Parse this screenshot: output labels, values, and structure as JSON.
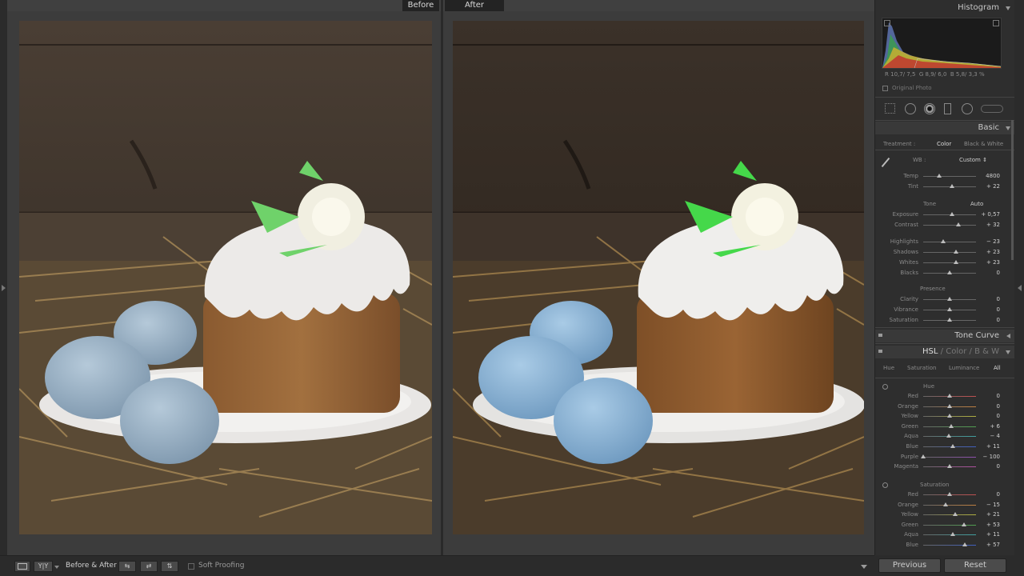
{
  "views": {
    "before_label": "Before",
    "after_label": "After"
  },
  "histogram": {
    "title": "Histogram",
    "readout_r_label": "R",
    "readout_r": "10,7/ 7,5",
    "readout_g_label": "G",
    "readout_g": "8,9/ 6,0",
    "readout_b_label": "B",
    "readout_b": "5,8/ 3,3",
    "readout_pct": "%",
    "original_photo": "Original Photo"
  },
  "basic": {
    "title": "Basic",
    "treatment_label": "Treatment :",
    "color_label": "Color",
    "bw_label": "Black & White",
    "wb_label": "WB :",
    "wb_value": "Custom",
    "tone_label": "Tone",
    "auto_label": "Auto",
    "presence_label": "Presence",
    "sliders_wb": [
      {
        "label": "Temp",
        "value": "4800",
        "pos": 0.3
      },
      {
        "label": "Tint",
        "value": "+ 22",
        "pos": 0.55
      }
    ],
    "sliders_tone": [
      {
        "label": "Exposure",
        "value": "+ 0,57",
        "pos": 0.55
      },
      {
        "label": "Contrast",
        "value": "+ 32",
        "pos": 0.66
      }
    ],
    "sliders_tone2": [
      {
        "label": "Highlights",
        "value": "− 23",
        "pos": 0.38
      },
      {
        "label": "Shadows",
        "value": "+ 23",
        "pos": 0.62
      },
      {
        "label": "Whites",
        "value": "+ 23",
        "pos": 0.62
      },
      {
        "label": "Blacks",
        "value": "0",
        "pos": 0.5
      }
    ],
    "sliders_presence": [
      {
        "label": "Clarity",
        "value": "0",
        "pos": 0.5
      },
      {
        "label": "Vibrance",
        "value": "0",
        "pos": 0.5
      },
      {
        "label": "Saturation",
        "value": "0",
        "pos": 0.5
      }
    ]
  },
  "tone_curve": {
    "title": "Tone Curve"
  },
  "hsl": {
    "title_hsl": "HSL",
    "title_sep1": "/",
    "title_color": "Color",
    "title_sep2": "/",
    "title_bw": "B & W",
    "tabs": [
      "Hue",
      "Saturation",
      "Luminance",
      "All"
    ],
    "hue_label": "Hue",
    "saturation_label": "Saturation",
    "hue_sliders": [
      {
        "label": "Red",
        "value": "0",
        "pos": 0.5,
        "color": "#c05050"
      },
      {
        "label": "Orange",
        "value": "0",
        "pos": 0.5,
        "color": "#c08040"
      },
      {
        "label": "Yellow",
        "value": "0",
        "pos": 0.5,
        "color": "#b0b040"
      },
      {
        "label": "Green",
        "value": "+ 6",
        "pos": 0.53,
        "color": "#50a050"
      },
      {
        "label": "Aqua",
        "value": "− 4",
        "pos": 0.48,
        "color": "#40a0a0"
      },
      {
        "label": "Blue",
        "value": "+ 11",
        "pos": 0.56,
        "color": "#4060c0"
      },
      {
        "label": "Purple",
        "value": "− 100",
        "pos": 0.0,
        "color": "#9050b0"
      },
      {
        "label": "Magenta",
        "value": "0",
        "pos": 0.5,
        "color": "#b050a0"
      }
    ],
    "sat_sliders": [
      {
        "label": "Red",
        "value": "0",
        "pos": 0.5,
        "color": "#c05050"
      },
      {
        "label": "Orange",
        "value": "− 15",
        "pos": 0.42,
        "color": "#c08040"
      },
      {
        "label": "Yellow",
        "value": "+ 21",
        "pos": 0.6,
        "color": "#b0b040"
      },
      {
        "label": "Green",
        "value": "+ 53",
        "pos": 0.77,
        "color": "#50a050"
      },
      {
        "label": "Aqua",
        "value": "+ 11",
        "pos": 0.56,
        "color": "#40a0a0"
      },
      {
        "label": "Blue",
        "value": "+ 57",
        "pos": 0.79,
        "color": "#4060c0"
      }
    ]
  },
  "toolbar": {
    "before_after_label": "Before & After :",
    "yy_label": "Y|Y",
    "soft_proofing": "Soft Proofing"
  },
  "bottom_buttons": {
    "previous": "Previous",
    "reset": "Reset"
  }
}
